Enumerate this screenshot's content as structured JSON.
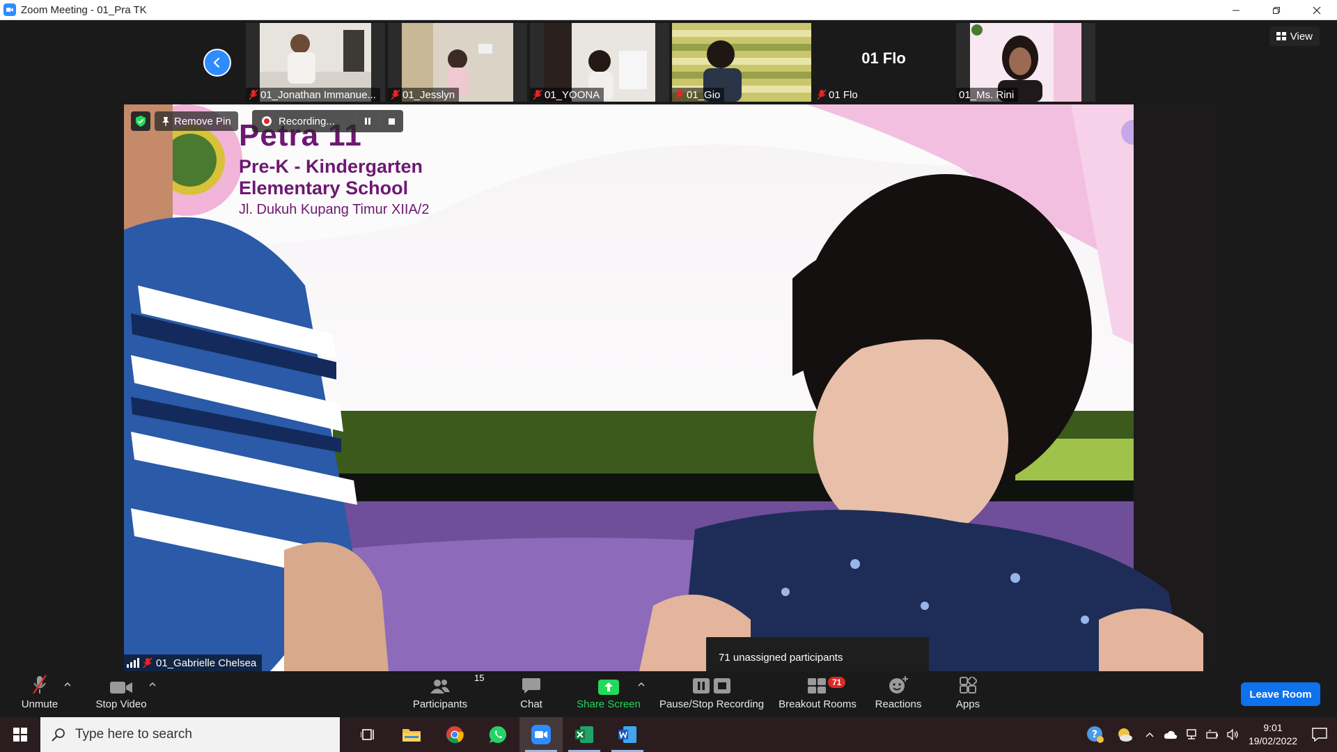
{
  "window": {
    "title": "Zoom Meeting - 01_Pra TK"
  },
  "view_button": {
    "label": "View"
  },
  "thumbnails": [
    {
      "name": "01_Jonathan Immanue...",
      "muted": true,
      "video": true
    },
    {
      "name": "01_Jesslyn",
      "muted": true,
      "video": true
    },
    {
      "name": "01_YOONA",
      "muted": true,
      "video": true
    },
    {
      "name": "01_Gio",
      "muted": true,
      "video": true
    },
    {
      "name": "01 Flo",
      "muted": true,
      "video": false,
      "display_name": "01 Flo"
    },
    {
      "name": "01_Ms. Rini",
      "muted": false,
      "video": true
    }
  ],
  "speaker": {
    "name": "01_Gabrielle Chelsea",
    "remove_pin_label": "Remove Pin",
    "recording_label": "Recording...",
    "background_text": {
      "line1": "Petra 11",
      "line2": "Pre-K  - Kindergarten",
      "line3": "Elementary School",
      "line4": "Jl. Dukuh Kupang Timur XIIA/2"
    }
  },
  "tooltip": {
    "text": "71 unassigned participants"
  },
  "controls": {
    "unmute": "Unmute",
    "stop_video": "Stop Video",
    "participants": "Participants",
    "participants_count": "15",
    "chat": "Chat",
    "share_screen": "Share Screen",
    "pause_stop_recording": "Pause/Stop Recording",
    "breakout_rooms": "Breakout Rooms",
    "breakout_badge": "71",
    "reactions": "Reactions",
    "apps": "Apps",
    "leave_room": "Leave Room"
  },
  "colors": {
    "zoom_blue": "#2d8cff",
    "share_green": "#23d959",
    "leave_blue": "#0e72ed",
    "badge_red": "#e02828",
    "mute_red": "#e02828"
  },
  "taskbar": {
    "search_placeholder": "Type here to search",
    "time": "9:01",
    "date": "19/02/2022"
  }
}
